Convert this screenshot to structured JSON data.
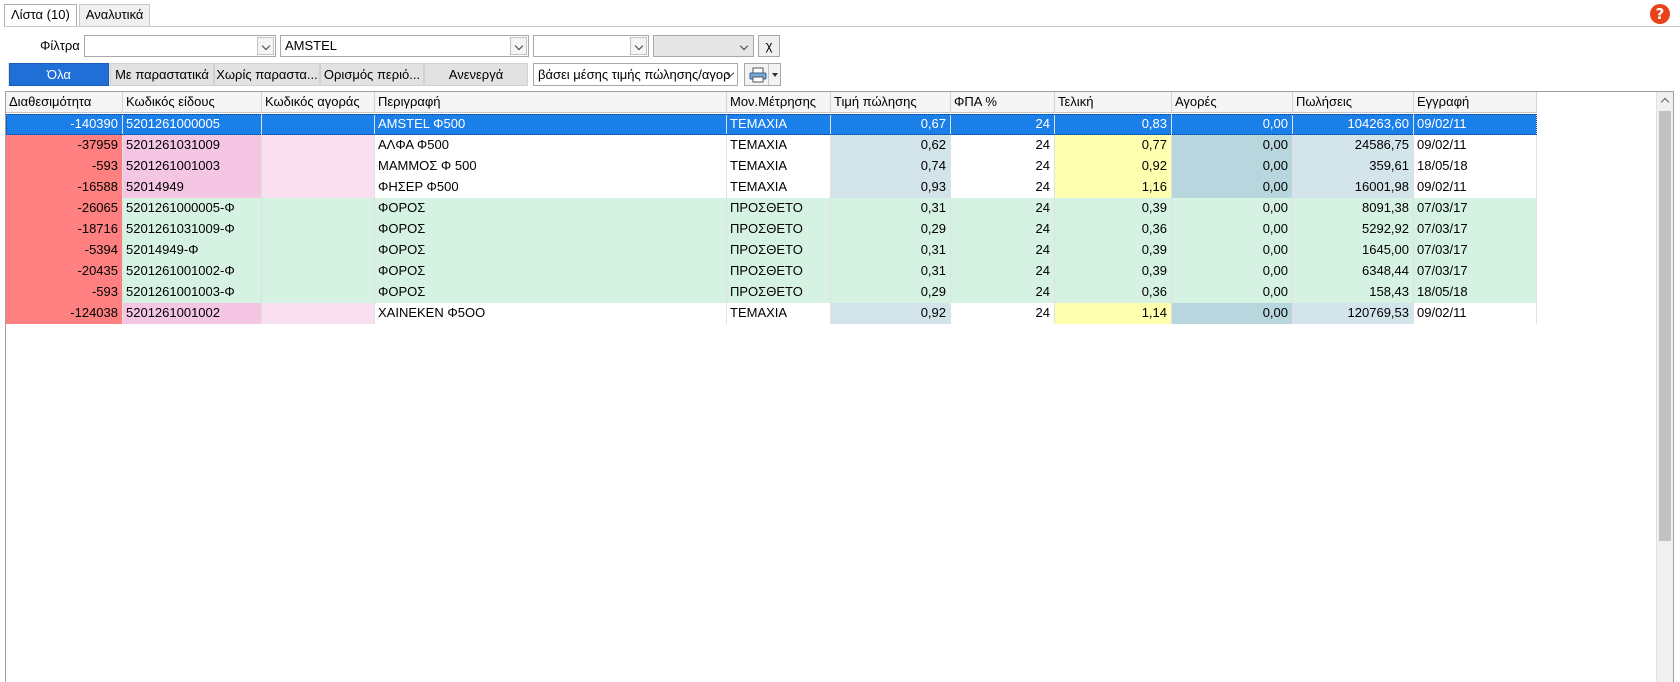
{
  "tabs": [
    {
      "label": "Λίστα (10)",
      "active": true
    },
    {
      "label": "Αναλυτικά",
      "active": false
    }
  ],
  "help_glyph": "?",
  "filters": {
    "label": "Φίλτρα",
    "combo1_value": "",
    "combo2_value": "AMSTEL",
    "combo3_value": "",
    "combo4_value": "",
    "clear_label": "χ"
  },
  "segments": [
    {
      "label": "Όλα",
      "active": true
    },
    {
      "label": "Με παραστατικά",
      "active": false
    },
    {
      "label": "Χωρίς παραστα...",
      "active": false
    },
    {
      "label": "Ορισμός περιό...",
      "active": false
    },
    {
      "label": "Ανενεργά",
      "active": false
    }
  ],
  "mode_select": "βάσει μέσης τιμής πώλησης/αγορ",
  "print_icon": "printer-icon",
  "colors": {
    "selected": "#1a7fe8",
    "avail_red": "#ff8080",
    "code_pink": "#f4c6e3",
    "buycode_pink": "#f9e0f0",
    "green_row": "#d5f2e2",
    "price_blue": "#d2e3ea",
    "final_yellow": "#ffffb0",
    "buys_teal": "#b7d6dd",
    "sales_blue": "#d3e4eb"
  },
  "columns": [
    "Διαθεσιμότητα",
    "Κωδικός είδους",
    "Κωδικός αγοράς",
    "Περιγραφή",
    "Μον.Μέτρησης",
    "Τιμή πώλησης",
    "ΦΠΑ %",
    "Τελική",
    "Αγορές",
    "Πωλήσεις",
    "Εγγραφή"
  ],
  "rows": [
    {
      "avail": "-140390",
      "code": "5201261000005",
      "buycode": "",
      "desc": "AMSTEL  Φ500",
      "unit": "ΤΕΜΑΧΙΑ",
      "price": "0,67",
      "vat": "24",
      "final": "0,83",
      "buys": "0,00",
      "sales": "104263,60",
      "date": "09/02/11",
      "kind": "item",
      "selected": true
    },
    {
      "avail": "-37959",
      "code": "5201261031009",
      "buycode": "",
      "desc": "ΑΛΦΑ Φ500",
      "unit": "ΤΕΜΑΧΙΑ",
      "price": "0,62",
      "vat": "24",
      "final": "0,77",
      "buys": "0,00",
      "sales": "24586,75",
      "date": "09/02/11",
      "kind": "item",
      "selected": false
    },
    {
      "avail": "-593",
      "code": "5201261001003",
      "buycode": "",
      "desc": "ΜΑΜΜΟΣ Φ 500",
      "unit": "ΤΕΜΑΧΙΑ",
      "price": "0,74",
      "vat": "24",
      "final": "0,92",
      "buys": "0,00",
      "sales": "359,61",
      "date": "18/05/18",
      "kind": "item",
      "selected": false
    },
    {
      "avail": "-16588",
      "code": "52014949",
      "buycode": "",
      "desc": "ΦΗΣΕΡ Φ500",
      "unit": "ΤΕΜΑΧΙΑ",
      "price": "0,93",
      "vat": "24",
      "final": "1,16",
      "buys": "0,00",
      "sales": "16001,98",
      "date": "09/02/11",
      "kind": "item",
      "selected": false
    },
    {
      "avail": "-26065",
      "code": "5201261000005-Φ",
      "buycode": "",
      "desc": "ΦΟΡΟΣ",
      "unit": "ΠΡΟΣΘΕΤΟ",
      "price": "0,31",
      "vat": "24",
      "final": "0,39",
      "buys": "0,00",
      "sales": "8091,38",
      "date": "07/03/17",
      "kind": "tax",
      "selected": false
    },
    {
      "avail": "-18716",
      "code": "5201261031009-Φ",
      "buycode": "",
      "desc": "ΦΟΡΟΣ",
      "unit": "ΠΡΟΣΘΕΤΟ",
      "price": "0,29",
      "vat": "24",
      "final": "0,36",
      "buys": "0,00",
      "sales": "5292,92",
      "date": "07/03/17",
      "kind": "tax",
      "selected": false
    },
    {
      "avail": "-5394",
      "code": "52014949-Φ",
      "buycode": "",
      "desc": "ΦΟΡΟΣ",
      "unit": "ΠΡΟΣΘΕΤΟ",
      "price": "0,31",
      "vat": "24",
      "final": "0,39",
      "buys": "0,00",
      "sales": "1645,00",
      "date": "07/03/17",
      "kind": "tax",
      "selected": false
    },
    {
      "avail": "-20435",
      "code": "5201261001002-Φ",
      "buycode": "",
      "desc": "ΦΟΡΟΣ",
      "unit": "ΠΡΟΣΘΕΤΟ",
      "price": "0,31",
      "vat": "24",
      "final": "0,39",
      "buys": "0,00",
      "sales": "6348,44",
      "date": "07/03/17",
      "kind": "tax",
      "selected": false
    },
    {
      "avail": "-593",
      "code": "5201261001003-Φ",
      "buycode": "",
      "desc": "ΦΟΡΟΣ",
      "unit": "ΠΡΟΣΘΕΤΟ",
      "price": "0,29",
      "vat": "24",
      "final": "0,36",
      "buys": "0,00",
      "sales": "158,43",
      "date": "18/05/18",
      "kind": "tax",
      "selected": false
    },
    {
      "avail": "-124038",
      "code": "5201261001002",
      "buycode": "",
      "desc": "ΧΑΙΝΕΚΕΝ Φ5ΟΟ",
      "unit": "ΤΕΜΑΧΙΑ",
      "price": "0,92",
      "vat": "24",
      "final": "1,14",
      "buys": "0,00",
      "sales": "120769,53",
      "date": "09/02/11",
      "kind": "item",
      "selected": false
    }
  ]
}
